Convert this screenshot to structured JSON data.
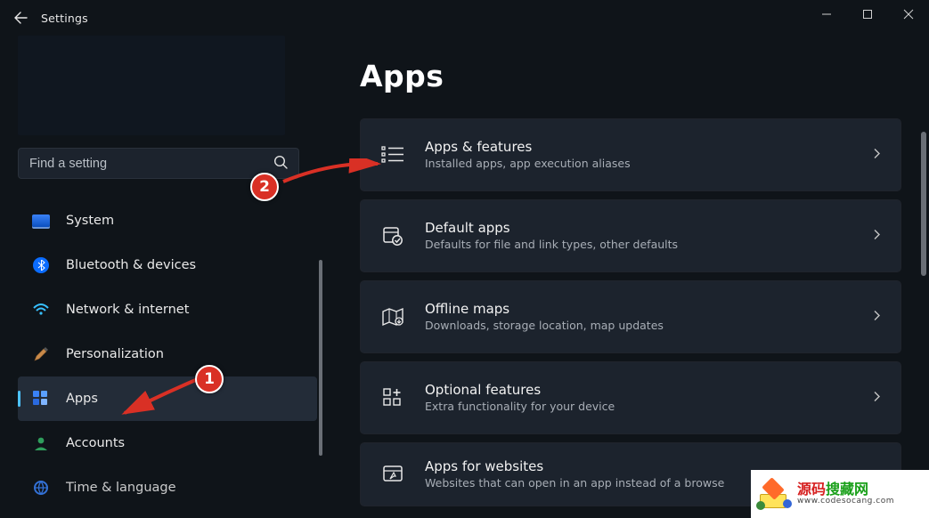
{
  "app": {
    "title": "Settings"
  },
  "search": {
    "placeholder": "Find a setting"
  },
  "sidebar": {
    "items": [
      {
        "label": "System"
      },
      {
        "label": "Bluetooth & devices"
      },
      {
        "label": "Network & internet"
      },
      {
        "label": "Personalization"
      },
      {
        "label": "Apps"
      },
      {
        "label": "Accounts"
      },
      {
        "label": "Time & language"
      }
    ],
    "active_index": 4
  },
  "page": {
    "title": "Apps"
  },
  "cards": [
    {
      "title": "Apps & features",
      "sub": "Installed apps, app execution aliases"
    },
    {
      "title": "Default apps",
      "sub": "Defaults for file and link types, other defaults"
    },
    {
      "title": "Offline maps",
      "sub": "Downloads, storage location, map updates"
    },
    {
      "title": "Optional features",
      "sub": "Extra functionality for your device"
    },
    {
      "title": "Apps for websites",
      "sub": "Websites that can open in an app instead of a browse"
    }
  ],
  "annotations": {
    "badge1": "1",
    "badge2": "2"
  },
  "watermark": {
    "cn_red": "源码",
    "cn_green": "搜藏网",
    "url": "www.codesocang.com"
  }
}
